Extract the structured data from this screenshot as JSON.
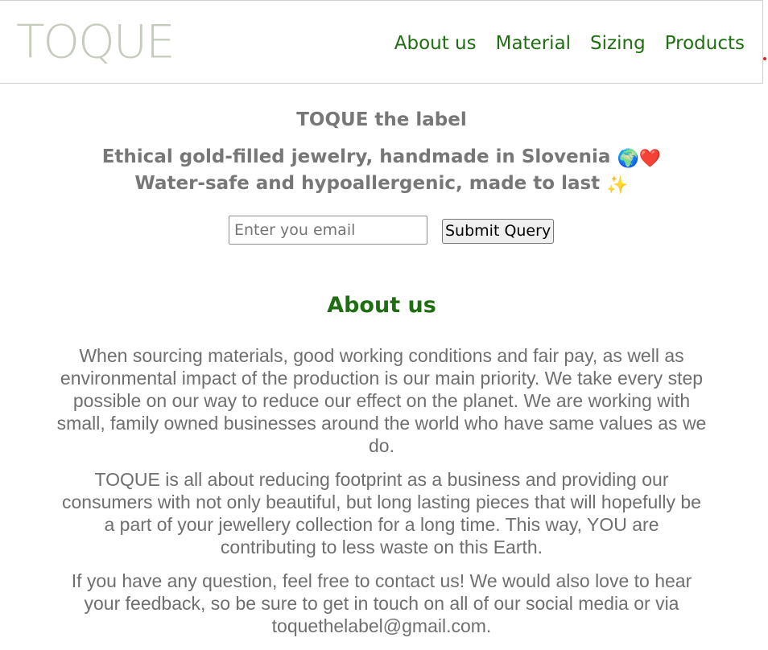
{
  "header": {
    "logo": "TOQUE",
    "nav": [
      "About us",
      "Material",
      "Sizing",
      "Products"
    ]
  },
  "hero": {
    "title": "TOQUE the label",
    "line1": "Ethical gold-filled jewelry, handmade in Slovenia",
    "line1_emojis": "🌍❤️",
    "line2": "Water-safe and hypoallergenic, made to last",
    "line2_emoji": "✨"
  },
  "signup": {
    "placeholder": "Enter you email",
    "button": "Submit Query"
  },
  "about": {
    "title": "About us",
    "paragraphs": [
      "When sourcing materials, good working conditions and fair pay, as well as environmental impact of the production is our main priority. We take every step possible on our way to reduce our effect on the planet. We are working with small, family owned businesses around the world who have same values as we do.",
      "TOQUE is all about reducing footprint as a business and providing our consumers with not only beautiful, but long lasting pieces that will hopefully be a part of your jewellery collection for a long time. This way, YOU are contributing to less waste on this Earth.",
      "If you have any question, feel free to contact us! We would also love to hear your feedback, so be sure to get in touch on all of our social media or via toquethelabel@gmail.com."
    ]
  },
  "colors": {
    "accent_green": "#1f6e12",
    "logo_gray_green": "#c5ccbd",
    "text_gray": "#777777"
  }
}
